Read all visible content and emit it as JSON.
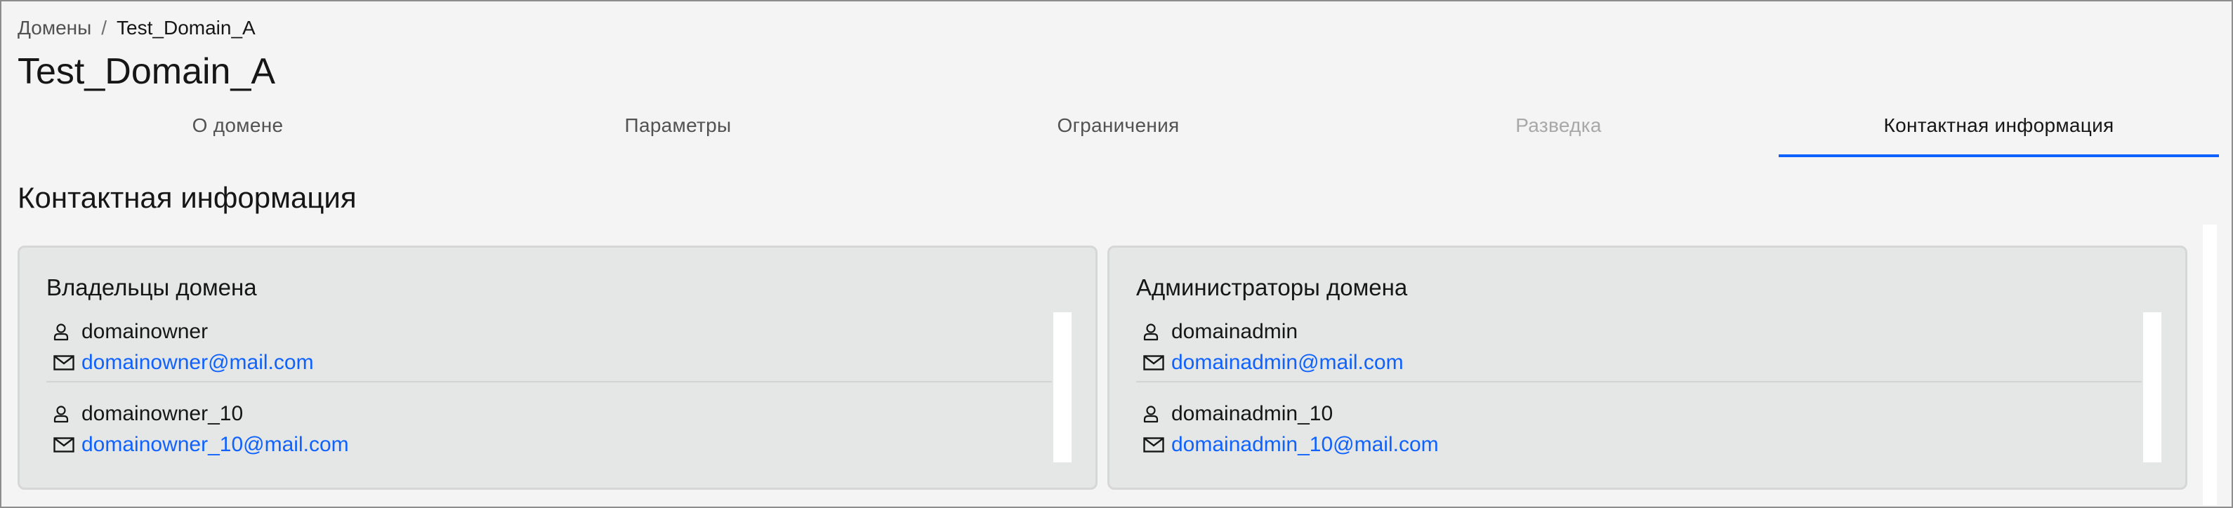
{
  "breadcrumb": {
    "parent": "Домены",
    "separator": "/",
    "current": "Test_Domain_A"
  },
  "page_title": "Test_Domain_A",
  "tabs": [
    {
      "label": "О домене",
      "state": "default"
    },
    {
      "label": "Параметры",
      "state": "default"
    },
    {
      "label": "Ограничения",
      "state": "default"
    },
    {
      "label": "Разведка",
      "state": "disabled"
    },
    {
      "label": "Контактная информация",
      "state": "active"
    }
  ],
  "section_title": "Контактная информация",
  "owners": {
    "title": "Владельцы домена",
    "contacts": [
      {
        "name": "domainowner",
        "email": "domainowner@mail.com"
      },
      {
        "name": "domainowner_10",
        "email": "domainowner_10@mail.com"
      }
    ]
  },
  "admins": {
    "title": "Администраторы домена",
    "contacts": [
      {
        "name": "domainadmin",
        "email": "domainadmin@mail.com"
      },
      {
        "name": "domainadmin_10",
        "email": "domainadmin_10@mail.com"
      }
    ]
  },
  "icons": {
    "user": "user-icon",
    "email": "email-icon"
  },
  "colors": {
    "accent": "#0f62fe",
    "link": "#0f62fe",
    "background": "#f4f4f4",
    "card": "#e5e6e6"
  }
}
